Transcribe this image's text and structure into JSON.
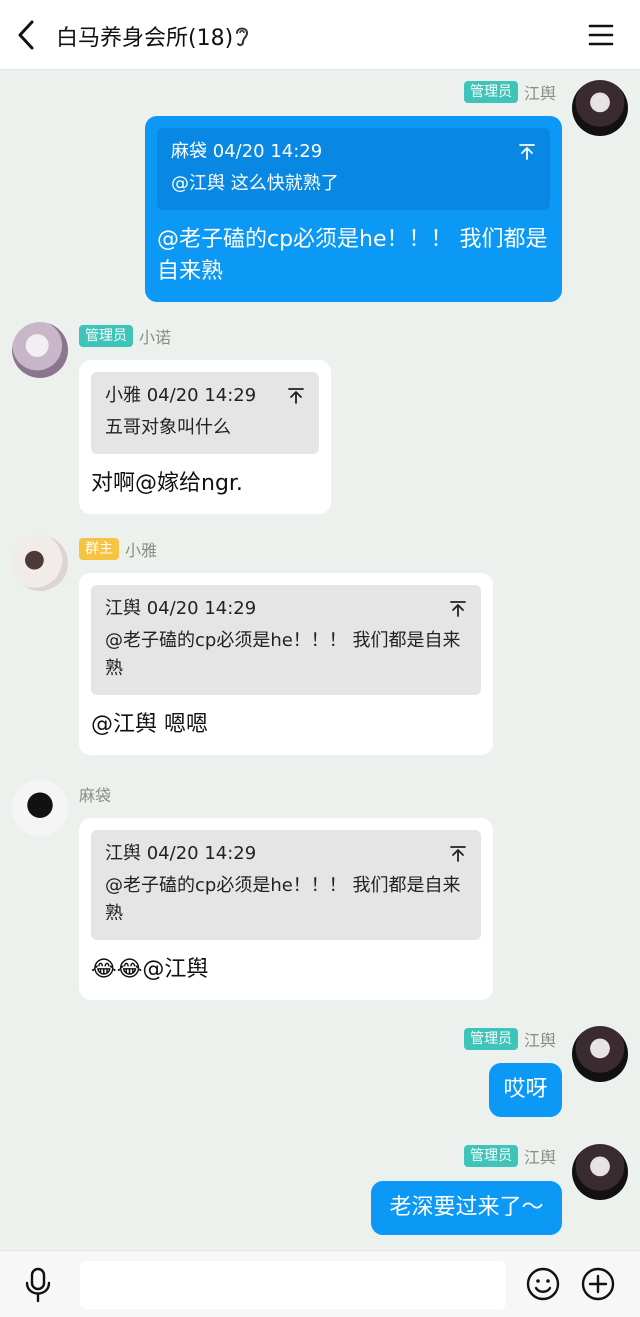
{
  "header": {
    "title": "白马养身会所(18)"
  },
  "messages": [
    {
      "sender": "江舆",
      "badge": "管理员",
      "quote_author_time": "麻袋 04/20 14:29",
      "quote_text": "@江舆 这么快就熟了",
      "text": "@老子磕的cp必须是he！！！ 我们都是自来熟"
    },
    {
      "sender": "小诺",
      "badge": "管理员",
      "quote_author_time": "小雅 04/20 14:29",
      "quote_text": "五哥对象叫什么",
      "text": "对啊@嫁给ngr."
    },
    {
      "sender": "小雅",
      "badge": "群主",
      "quote_author_time": "江舆 04/20 14:29",
      "quote_text": "@老子磕的cp必须是he！！！ 我们都是自来熟",
      "text": "@江舆 嗯嗯"
    },
    {
      "sender": "麻袋",
      "quote_author_time": "江舆 04/20 14:29",
      "quote_text": "@老子磕的cp必须是he！！！ 我们都是自来熟",
      "text": "😂😂@江舆"
    },
    {
      "sender": "江舆",
      "badge": "管理员",
      "text": "哎呀"
    },
    {
      "sender": "江舆",
      "badge": "管理员",
      "text": "老深要过来了～"
    }
  ],
  "input": {
    "placeholder": ""
  },
  "colors": {
    "mine_bubble": "#0c99f5",
    "background": "#edf1ee",
    "admin_badge": "#3ec4b8",
    "owner_badge": "#f6c343"
  },
  "icons": [
    "back-arrow-icon",
    "ear-icon",
    "menu-icon",
    "pin-top-icon",
    "microphone-icon",
    "emoji-icon",
    "plus-icon"
  ]
}
